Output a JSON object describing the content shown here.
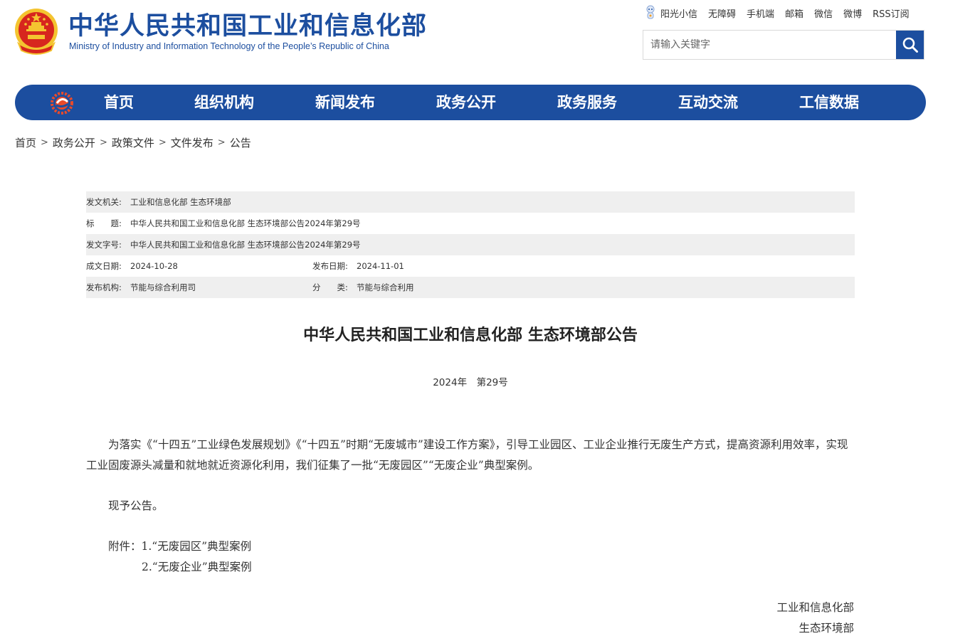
{
  "header": {
    "site_title": "中华人民共和国工业和信息化部",
    "site_subtitle": "Ministry of Industry and Information Technology of the People’s Republic of China",
    "top_links": [
      "阳光小信",
      "无障碍",
      "手机端",
      "邮箱",
      "微信",
      "微博",
      "RSS订阅"
    ],
    "search_placeholder": "请输入关键字",
    "colors": {
      "brand_blue": "#1c4e9f",
      "emblem_red": "#d7261e",
      "emblem_gold": "#f4c430"
    }
  },
  "nav": {
    "items": [
      "首页",
      "组织机构",
      "新闻发布",
      "政务公开",
      "政务服务",
      "互动交流",
      "工信数据"
    ]
  },
  "breadcrumb": [
    "首页",
    "政务公开",
    "政策文件",
    "文件发布",
    "公告"
  ],
  "meta": {
    "issuer_label": "发文机关:",
    "issuer": "工业和信息化部 生态环境部",
    "title_label": "标　　题:",
    "title": "中华人民共和国工业和信息化部 生态环境部公告2024年第29号",
    "doc_no_label": "发文字号:",
    "doc_no": "中华人民共和国工业和信息化部 生态环境部公告2024年第29号",
    "written_date_label": "成文日期:",
    "written_date": "2024-10-28",
    "publish_date_label": "发布日期:",
    "publish_date": "2024-11-01",
    "agency_label": "发布机构:",
    "agency": "节能与综合利用司",
    "category_label": "分　　类:",
    "category": "节能与综合利用"
  },
  "document": {
    "heading": "中华人民共和国工业和信息化部 生态环境部公告",
    "number": "2024年　第29号",
    "paragraph1": "为落实《“十四五”工业绿色发展规划》《“十四五”时期“无废城市”建设工作方案》，引导工业园区、工业企业推行无废生产方式，提高资源利用效率，实现工业固废源头减量和就地就近资源化利用，我们征集了一批“无废园区”“无废企业”典型案例。",
    "paragraph2": "现予公告。",
    "attachment_label": "附件：",
    "attachments": [
      "1.“无废园区”典型案例",
      "2.“无废企业”典型案例"
    ],
    "signatures": [
      "工业和信息化部",
      "生态环境部"
    ]
  }
}
